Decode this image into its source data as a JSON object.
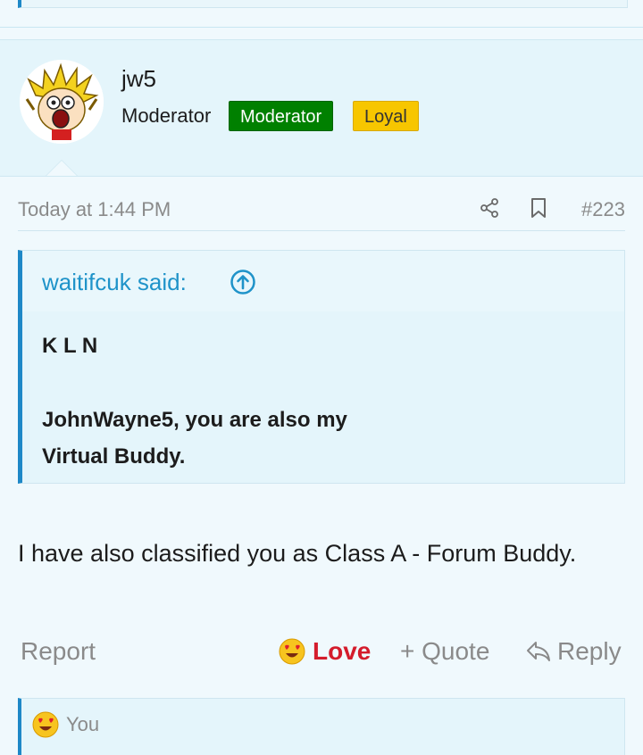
{
  "post": {
    "username": "jw5",
    "user_title": "Moderator",
    "badges": [
      "Moderator",
      "Loyal"
    ],
    "timestamp": "Today at 1:44 PM",
    "post_number": "#223",
    "quote": {
      "author": "waitifcuk said:",
      "lines": [
        "K L N",
        "JohnWayne5, you are also my",
        "Virtual Buddy."
      ]
    },
    "message": "I have also classified you as Class A - Forum Buddy.",
    "actions": {
      "report": "Report",
      "love": "Love",
      "quote": "+ Quote",
      "reply": "Reply"
    },
    "reactions": {
      "text": "You"
    }
  },
  "colors": {
    "accent": "#1e88c7",
    "badge_moderator": "#008000",
    "badge_loyal": "#f7c600",
    "love": "#d41c2c"
  },
  "icons": [
    "share-icon",
    "bookmark-icon",
    "arrow-up-circle-icon",
    "heart-eyes-emoji-icon",
    "reply-arrow-icon"
  ]
}
